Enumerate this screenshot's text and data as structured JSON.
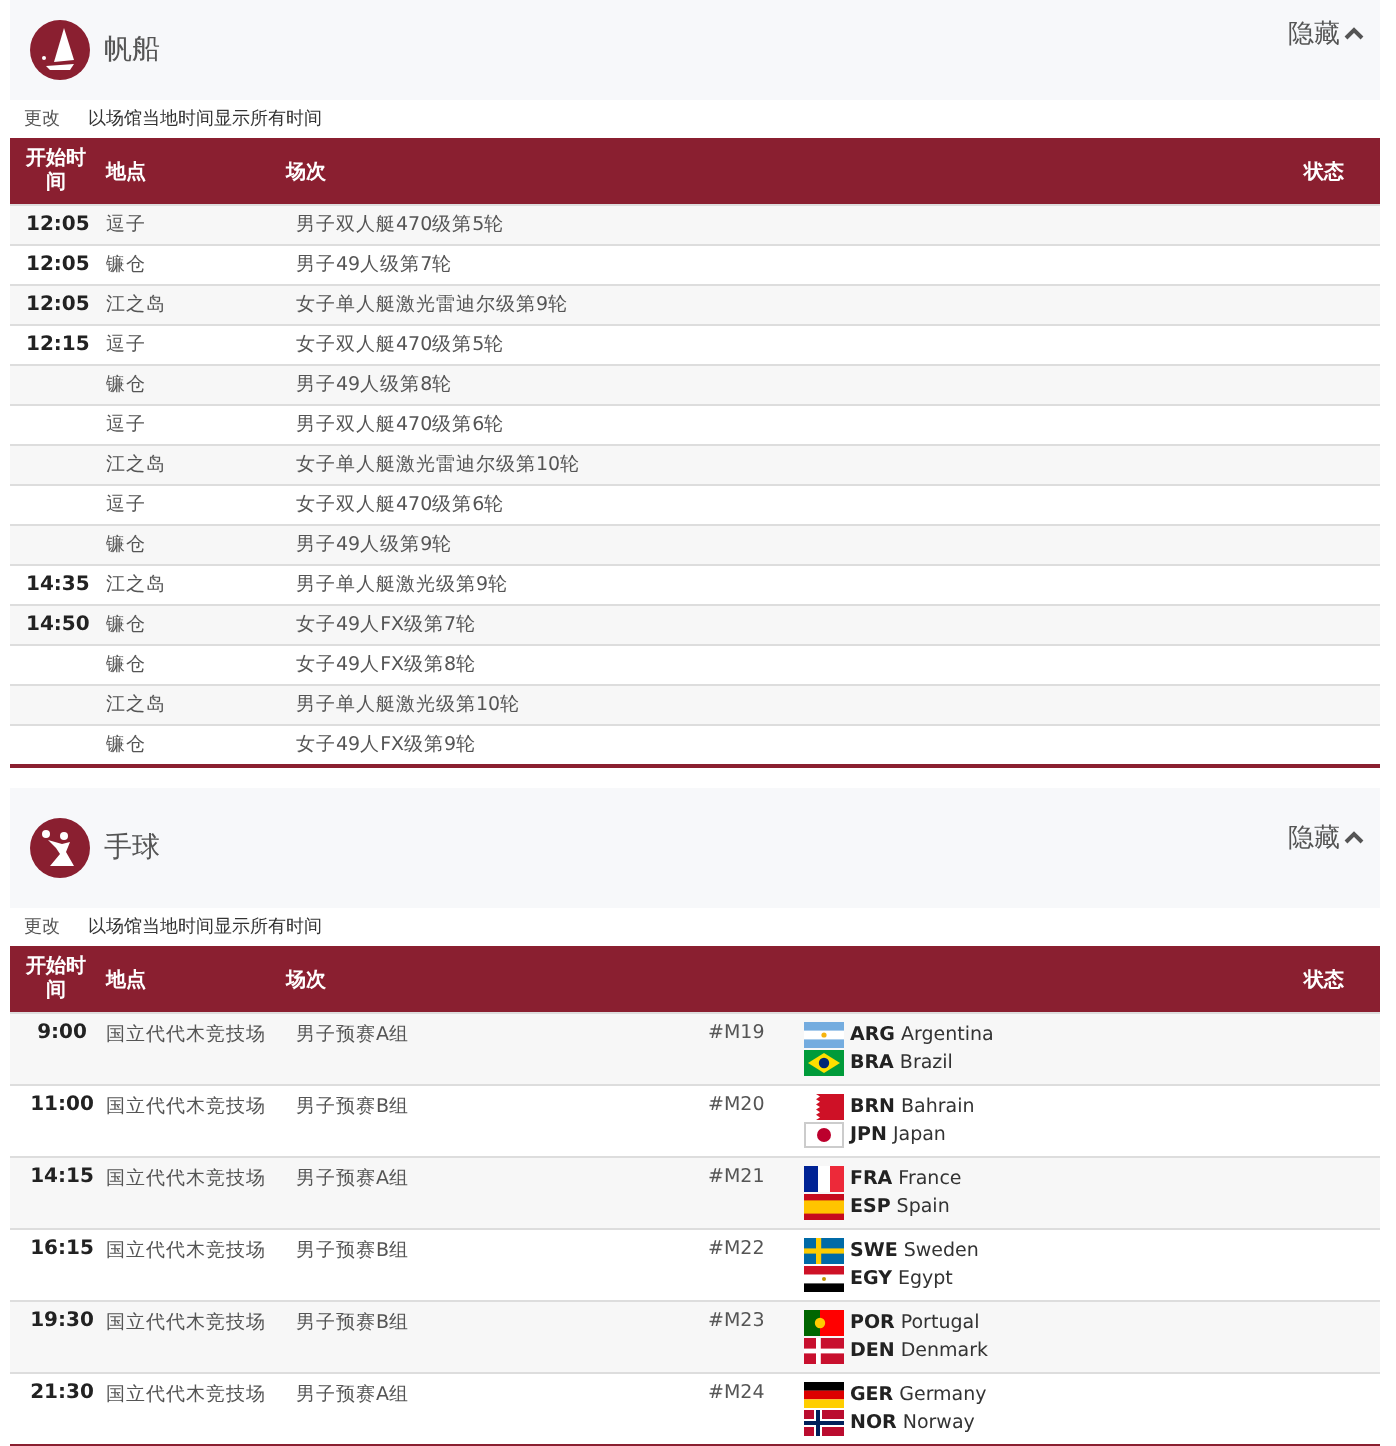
{
  "sections": [
    {
      "title": "帆船",
      "kind": "sailing",
      "toggle": "隐藏",
      "expanded": true,
      "note_link": "更改",
      "note": "以场馆当地时间显示所有时间",
      "columns": {
        "time": "开始时间",
        "venue": "地点",
        "event": "场次",
        "status": "状态"
      },
      "rows": [
        {
          "time": "12:05",
          "venue": "逗子",
          "event": "男子双人艇470级第5轮"
        },
        {
          "time": "12:05",
          "venue": "镰仓",
          "event": "男子49人级第7轮"
        },
        {
          "time": "12:05",
          "venue": "江之岛",
          "event": "女子单人艇激光雷迪尔级第9轮"
        },
        {
          "time": "12:15",
          "venue": "逗子",
          "event": "女子双人艇470级第5轮"
        },
        {
          "venue": "镰仓",
          "event": "男子49人级第8轮"
        },
        {
          "venue": "逗子",
          "event": "男子双人艇470级第6轮"
        },
        {
          "venue": "江之岛",
          "event": "女子单人艇激光雷迪尔级第10轮"
        },
        {
          "venue": "逗子",
          "event": "女子双人艇470级第6轮"
        },
        {
          "venue": "镰仓",
          "event": "男子49人级第9轮"
        },
        {
          "time": "14:35",
          "venue": "江之岛",
          "event": "男子单人艇激光级第9轮"
        },
        {
          "time": "14:50",
          "venue": "镰仓",
          "event": "女子49人FX级第7轮"
        },
        {
          "venue": "镰仓",
          "event": "女子49人FX级第8轮"
        },
        {
          "venue": "江之岛",
          "event": "男子单人艇激光级第10轮"
        },
        {
          "venue": "镰仓",
          "event": "女子49人FX级第9轮"
        }
      ]
    },
    {
      "title": "手球",
      "kind": "handball",
      "toggle": "隐藏",
      "expanded": true,
      "note_link": "更改",
      "note": "以场馆当地时间显示所有时间",
      "columns": {
        "time": "开始时间",
        "venue": "地点",
        "event": "场次",
        "status": "状态"
      },
      "rows": [
        {
          "time": "9:00",
          "venue": "国立代代木竞技场",
          "event": "男子预赛A组",
          "match": "#M19",
          "teams": [
            {
              "code": "ARG",
              "name": "Argentina",
              "kind": "arg"
            },
            {
              "code": "BRA",
              "name": "Brazil",
              "kind": "bra"
            }
          ]
        },
        {
          "time": "11:00",
          "venue": "国立代代木竞技场",
          "event": "男子预赛B组",
          "match": "#M20",
          "teams": [
            {
              "code": "BRN",
              "name": "Bahrain",
              "kind": "brn"
            },
            {
              "code": "JPN",
              "name": "Japan",
              "kind": "jpn"
            }
          ]
        },
        {
          "time": "14:15",
          "venue": "国立代代木竞技场",
          "event": "男子预赛A组",
          "match": "#M21",
          "teams": [
            {
              "code": "FRA",
              "name": "France",
              "kind": "fra"
            },
            {
              "code": "ESP",
              "name": "Spain",
              "kind": "esp"
            }
          ]
        },
        {
          "time": "16:15",
          "venue": "国立代代木竞技场",
          "event": "男子预赛B组",
          "match": "#M22",
          "teams": [
            {
              "code": "SWE",
              "name": "Sweden",
              "kind": "swe"
            },
            {
              "code": "EGY",
              "name": "Egypt",
              "kind": "egy"
            }
          ]
        },
        {
          "time": "19:30",
          "venue": "国立代代木竞技场",
          "event": "男子预赛B组",
          "match": "#M23",
          "teams": [
            {
              "code": "POR",
              "name": "Portugal",
              "kind": "por"
            },
            {
              "code": "DEN",
              "name": "Denmark",
              "kind": "den"
            }
          ]
        },
        {
          "time": "21:30",
          "venue": "国立代代木竞技场",
          "event": "男子预赛A组",
          "match": "#M24",
          "teams": [
            {
              "code": "GER",
              "name": "Germany",
              "kind": "ger"
            },
            {
              "code": "NOR",
              "name": "Norway",
              "kind": "nor"
            }
          ]
        }
      ]
    }
  ]
}
